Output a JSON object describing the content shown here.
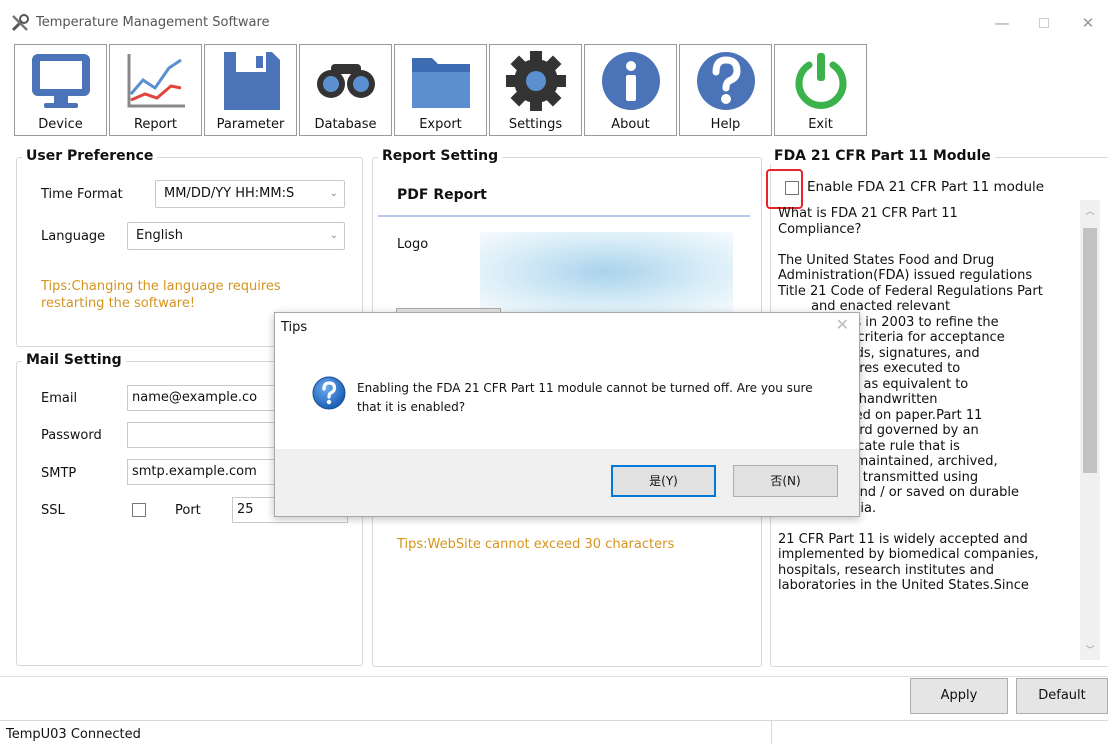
{
  "window": {
    "title": "Temperature Management Software",
    "icons": [
      "tools-icon",
      "minimize-icon",
      "maximize-icon",
      "close-icon"
    ]
  },
  "toolbar": {
    "buttons": [
      {
        "label": "Device",
        "icon": "monitor-icon"
      },
      {
        "label": "Report",
        "icon": "line-chart-icon"
      },
      {
        "label": "Parameter",
        "icon": "floppy-disk-icon"
      },
      {
        "label": "Database",
        "icon": "binoculars-icon"
      },
      {
        "label": "Export",
        "icon": "folder-icon"
      },
      {
        "label": "Settings",
        "icon": "gear-icon"
      },
      {
        "label": "About",
        "icon": "info-icon"
      },
      {
        "label": "Help",
        "icon": "question-icon"
      },
      {
        "label": "Exit",
        "icon": "power-icon"
      }
    ]
  },
  "user_preference": {
    "title": "User Preference",
    "time_format_label": "Time Format",
    "time_format_value": "MM/DD/YY HH:MM:S",
    "language_label": "Language",
    "language_value": "English",
    "tips": "Tips:Changing the language requires restarting the software!"
  },
  "mail_setting": {
    "title": "Mail Setting",
    "email_label": "Email",
    "email_value": "name@example.co",
    "password_label": "Password",
    "password_value": "",
    "smtp_label": "SMTP",
    "smtp_value": "smtp.example.com",
    "ssl_label": "SSL",
    "port_label": "Port",
    "port_value": "25"
  },
  "report_setting": {
    "title": "Report Setting",
    "tab": "PDF Report",
    "logo_label": "Logo",
    "tips": "Tips:WebSite cannot exceed 30 characters"
  },
  "fda": {
    "title": "FDA 21 CFR Part 11 Module",
    "enable_label": "Enable FDA 21 CFR Part 11 module",
    "text": "What is FDA 21 CFR Part 11\nCompliance?\n\nThe United States Food and Drug\nAdministration(FDA) issued regulations\nTitle 21 Code of Federal Regulations Part\n        and enacted relevant\n        idelines in 2003 to refine the\n        ovides criteria for acceptance\n        c records, signatures, and\n        signatures executed to\n        records as equivalent to\n        ds and handwritten\n        executed on paper.Part 11\n        ny record governed by an\n        A predicate rule that is\n        dified, maintained, archived,\nretrieved, or transmitted using\ncomputers and / or saved on durable\nstorage media.\n\n21 CFR Part 11 is widely accepted and\nimplemented by biomedical companies,\nhospitals, research institutes and\nlaboratories in the United States.Since"
  },
  "buttons": {
    "apply": "Apply",
    "default": "Default"
  },
  "status": {
    "text": "TempU03 Connected"
  },
  "dialog": {
    "title": "Tips",
    "message": "Enabling the FDA 21 CFR Part 11 module cannot be turned off. Are you sure that it is enabled?",
    "yes": "是(Y)",
    "no": "否(N)",
    "icon": "question-icon"
  },
  "colors": {
    "tips": "#d4951f",
    "highlight": "#e8232a",
    "accent": "#0078d7"
  }
}
